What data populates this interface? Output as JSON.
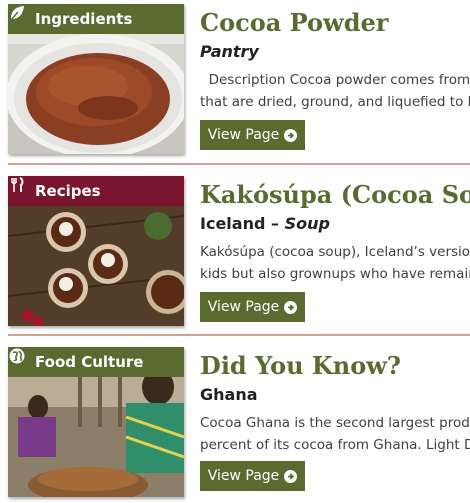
{
  "cards": [
    {
      "badge": "Ingredients",
      "badge_icon": "leaf-icon",
      "title": "Cocoa Powder",
      "subtitle_italic": "Pantry",
      "desc_lines": [
        "  Description Cocoa powder comes from t",
        "that are dried, ground, and liquefied to be"
      ],
      "button": "View Page"
    },
    {
      "badge": "Recipes",
      "badge_icon": "fork-knife-icon",
      "title": "Kakósúpa (Cocoa Soup)",
      "subtitle_plain": "Iceland – ",
      "subtitle_italic": "Soup",
      "desc_lines": [
        "Kakósúpa (cocoa soup), Iceland’s version o",
        "kids but also grownups who have remaine"
      ],
      "button": "View Page"
    },
    {
      "badge": "Food Culture",
      "badge_icon": "globe-icon",
      "title": "Did You Know?",
      "subtitle_plain": "Ghana",
      "desc_lines": [
        "Cocoa Ghana is the second largest produc",
        "percent of its cocoa from Ghana. Light Dri"
      ],
      "button": "View Page"
    }
  ],
  "colors": {
    "olive": "#5b6b2f",
    "maroon": "#7a1530",
    "divider": "#d9a08c"
  }
}
